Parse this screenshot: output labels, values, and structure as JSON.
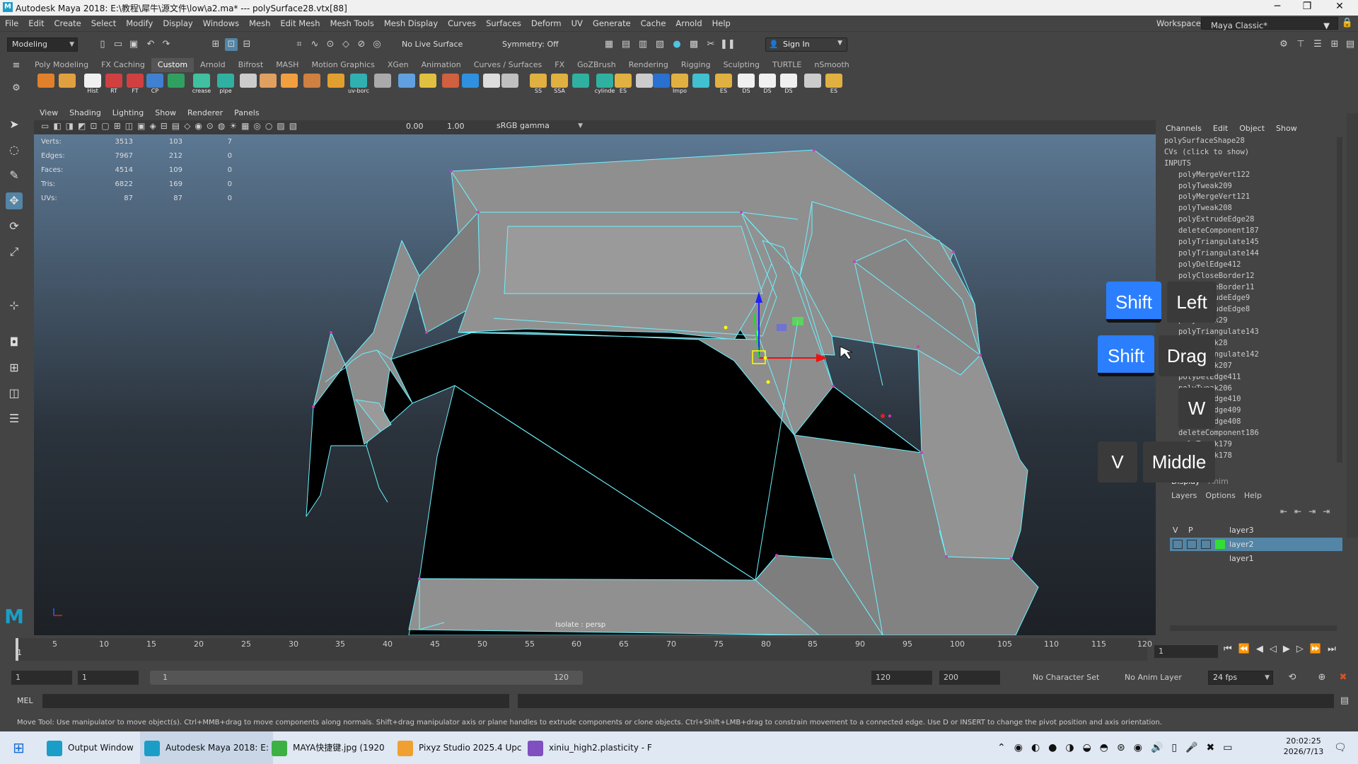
{
  "window": {
    "title": "Autodesk Maya 2018: E:\\教程\\犀牛\\源文件\\low\\a2.ma*   ---   polySurface28.vtx[88]"
  },
  "menubar": [
    "File",
    "Edit",
    "Create",
    "Select",
    "Modify",
    "Display",
    "Windows",
    "Mesh",
    "Edit Mesh",
    "Mesh Tools",
    "Mesh Display",
    "Curves",
    "Surfaces",
    "Deform",
    "UV",
    "Generate",
    "Cache",
    "Arnold",
    "Help"
  ],
  "workspace": {
    "label": "Workspace :",
    "value": "Maya Classic*"
  },
  "statusline": {
    "mode": "Modeling",
    "live_surface": "No Live Surface",
    "symmetry": "Symmetry: Off",
    "sign_in": "Sign In"
  },
  "shelf_tabs": [
    "Poly Modeling",
    "FX Caching",
    "Custom",
    "Arnold",
    "Bifrost",
    "MASH",
    "Motion Graphics",
    "XGen",
    "Animation",
    "Curves / Surfaces",
    "FX",
    "GoZBrush",
    "Rendering",
    "Rigging",
    "Sculpting",
    "TURTLE",
    "nSmooth"
  ],
  "shelf_active_tab": "Custom",
  "shelf_buttons": [
    "",
    "",
    "Hist",
    "RT",
    "FT",
    "CP",
    "",
    "crease",
    "pipe",
    "",
    "",
    "",
    "",
    "",
    "uv-borc",
    "",
    "",
    "",
    "",
    "",
    "",
    "",
    "SS",
    "SSA",
    "",
    "cylinde",
    "ES",
    "",
    "",
    "Impo",
    "",
    "ES",
    "DS",
    "DS",
    "DS",
    "",
    "ES"
  ],
  "viewport": {
    "menu": [
      "View",
      "Shading",
      "Lighting",
      "Show",
      "Renderer",
      "Panels"
    ],
    "field1": "0.00",
    "field2": "1.00",
    "color_space": "sRGB gamma",
    "label": "Isolate : persp",
    "hud": [
      {
        "k": "Verts:",
        "v": "3513",
        "v2": "103",
        "v3": "7"
      },
      {
        "k": "Edges:",
        "v": "7967",
        "v2": "212",
        "v3": "0"
      },
      {
        "k": "Faces:",
        "v": "4514",
        "v2": "109",
        "v3": "0"
      },
      {
        "k": "Tris:",
        "v": "6822",
        "v2": "169",
        "v3": "0"
      },
      {
        "k": "UVs:",
        "v": "87",
        "v2": "87",
        "v3": "0"
      }
    ]
  },
  "channelbox": {
    "menu": [
      "Channels",
      "Edit",
      "Object",
      "Show"
    ],
    "items": [
      "polySurfaceShape28",
      "CVs (click to show)",
      "INPUTS",
      "  polyMergeVert122",
      "  polyTweak209",
      "  polyMergeVert121",
      "  polyTweak208",
      "  polyExtrudeEdge28",
      "  deleteComponent187",
      "  polyTriangulate145",
      "  polyTriangulate144",
      "  polyDelEdge412",
      "  polyCloseBorder12",
      "  polyCloseBorder11",
      "  polyExtrudeEdge9",
      "  polyExtrudeEdge8",
      "  polyTweak29",
      "  polyTriangulate143",
      "  polyTweak28",
      "  polyTriangulate142",
      "  polyTweak207",
      "  polyDelEdge411",
      "  polyTweak206",
      "  polyDelEdge410",
      "  polyDelEdge409",
      "  polyDelEdge408",
      "  deleteComponent186",
      "  polyTweak179",
      "  polyTweak178"
    ]
  },
  "layer_editor": {
    "tabs": [
      "Display",
      "Anim"
    ],
    "menu": [
      "Layers",
      "Options",
      "Help"
    ],
    "header": [
      "V",
      "P"
    ],
    "layers": [
      {
        "name": "layer3",
        "selected": false,
        "color": ""
      },
      {
        "name": "layer2",
        "selected": true,
        "color": "#33dd33"
      },
      {
        "name": "layer1",
        "selected": false,
        "color": ""
      }
    ]
  },
  "keys_overlay": [
    {
      "label": "Shift",
      "style": "blue"
    },
    {
      "label": "Left",
      "style": "dark"
    },
    {
      "label": "Shift",
      "style": "blue"
    },
    {
      "label": "Drag",
      "style": "dark"
    },
    {
      "label": "W",
      "style": "dark"
    },
    {
      "label": "V",
      "style": "dark"
    },
    {
      "label": "Middle",
      "style": "dark"
    }
  ],
  "timeline": {
    "ticks": [
      "5",
      "10",
      "15",
      "20",
      "25",
      "30",
      "35",
      "40",
      "45",
      "50",
      "55",
      "60",
      "65",
      "70",
      "75",
      "80",
      "85",
      "90",
      "95",
      "100",
      "105",
      "110",
      "115",
      "120"
    ],
    "start_marker": "1",
    "current_frame": "1"
  },
  "range": {
    "start": "1",
    "playback_start": "1",
    "range_start": "1",
    "range_end": "120",
    "playback_end": "120",
    "end": "200",
    "character_set": "No Character Set",
    "anim_layer": "No Anim Layer",
    "fps": "24 fps"
  },
  "cmdline": {
    "lang": "MEL"
  },
  "helpline": "Move Tool: Use manipulator to move object(s). Ctrl+MMB+drag to move components along normals. Shift+drag manipulator axis or plane handles to extrude components or clone objects. Ctrl+Shift+LMB+drag to constrain movement to a connected edge. Use D or INSERT to change the pivot position and axis orientation.",
  "taskbar": {
    "items": [
      "Output Window",
      "Autodesk Maya 2018: E:",
      "MAYA快捷键.jpg (1920",
      "Pixyz Studio 2025.4 Upc",
      "xiniu_high2.plasticity - F"
    ],
    "time": "20:02:25",
    "date": "2026/7/13"
  },
  "colors": {
    "accent": "#2b7fff",
    "selection": "#5285a6",
    "wire": "#6cf2ff"
  }
}
